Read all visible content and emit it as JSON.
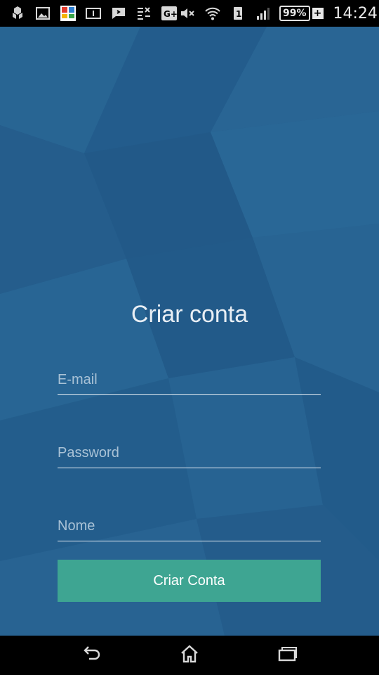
{
  "status_bar": {
    "clock": "14:24",
    "battery_percent": "99%",
    "battery_plus": "+",
    "sim_indicator": "1",
    "left_icons": [
      "apps-cube-icon",
      "image-icon",
      "avg-pro-icon",
      "sim-card-info-icon",
      "chat-bubble-icon",
      "sms-list-icon",
      "google-plus-icon"
    ],
    "right_icons": [
      "volume-muted-icon",
      "wifi-icon",
      "sim-1-icon",
      "signal-bars-icon",
      "battery-icon"
    ]
  },
  "form": {
    "title": "Criar conta",
    "email_placeholder": "E-mail",
    "password_placeholder": "Password",
    "name_placeholder": "Nome",
    "submit_label": "Criar Conta"
  },
  "nav_bar": {
    "icons": [
      "back-icon",
      "home-icon",
      "recent-apps-icon"
    ]
  },
  "colors": {
    "background": "#25608f",
    "button": "#3ea592",
    "text": "#e8eef4"
  }
}
